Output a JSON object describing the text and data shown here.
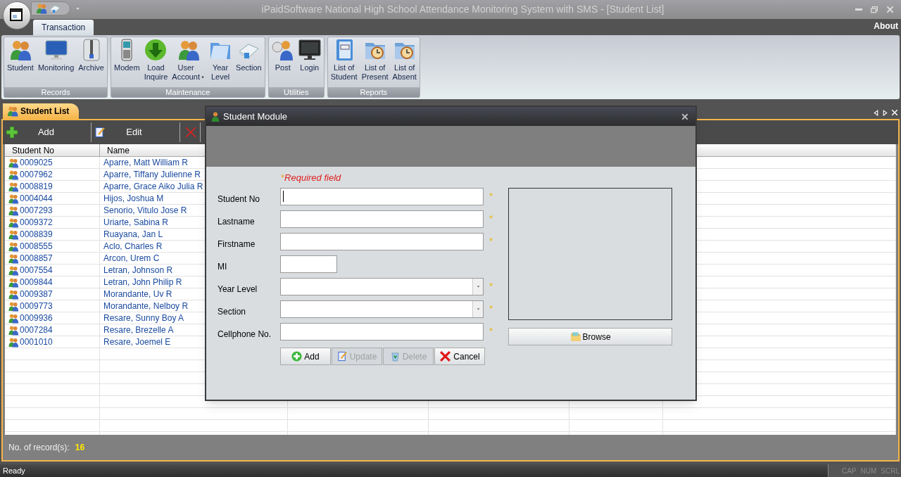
{
  "window": {
    "title": "iPaidSoftware National High School Attendance Monitoring System with SMS - [Student List]"
  },
  "ribbon_tabs": [
    {
      "label": "Transaction",
      "selected": true
    }
  ],
  "menu_right": "About",
  "ribbon_groups": [
    {
      "label": "Records",
      "buttons": [
        {
          "label": "Student"
        },
        {
          "label": "Monitoring"
        },
        {
          "label": "Archive"
        }
      ]
    },
    {
      "label": "Maintenance",
      "buttons": [
        {
          "label": "Modem"
        },
        {
          "label": "Load\nInquire"
        },
        {
          "label": "User\nAccount",
          "dropdown": true
        },
        {
          "label": "Year\nLevel"
        },
        {
          "label": "Section"
        }
      ]
    },
    {
      "label": "Utilities",
      "buttons": [
        {
          "label": "Post"
        },
        {
          "label": "Login"
        }
      ]
    },
    {
      "label": "Reports",
      "buttons": [
        {
          "label": "List of\nStudent"
        },
        {
          "label": "List of\nPresent"
        },
        {
          "label": "List of\nAbsent"
        }
      ]
    }
  ],
  "document_tabs": [
    {
      "label": "Student List",
      "selected": true
    }
  ],
  "toolbar": [
    {
      "kind": "button",
      "label": "Add"
    },
    {
      "kind": "button",
      "label": "Edit"
    },
    {
      "kind": "icon_button"
    }
  ],
  "table": {
    "columns": [
      "Student No",
      "Name"
    ],
    "rows": [
      {
        "student_no": "0009025",
        "name": "Aparre, Matt William R"
      },
      {
        "student_no": "0007962",
        "name": "Aparre, Tiffany Julienne R"
      },
      {
        "student_no": "0008819",
        "name": "Aparre, Grace Aiko Julia R"
      },
      {
        "student_no": "0004044",
        "name": "Hijos, Joshua M"
      },
      {
        "student_no": "0007293",
        "name": "Senorio, Vitulo Jose R"
      },
      {
        "student_no": "0009372",
        "name": "Uriarte, Sabina R"
      },
      {
        "student_no": "0008839",
        "name": "Ruayana, Jan L"
      },
      {
        "student_no": "0008555",
        "name": "Aclo, Charles R"
      },
      {
        "student_no": "0008857",
        "name": "Arcon, Urem C"
      },
      {
        "student_no": "0007554",
        "name": "Letran, Johnson R"
      },
      {
        "student_no": "0009844",
        "name": "Letran, John Philip R"
      },
      {
        "student_no": "0009387",
        "name": "Morandante, Uv R"
      },
      {
        "student_no": "0009773",
        "name": "Morandante, Nelboy R"
      },
      {
        "student_no": "0009936",
        "name": "Resare, Sunny Boy A"
      },
      {
        "student_no": "0007284",
        "name": "Resare, Brezelle A"
      },
      {
        "student_no": "0001010",
        "name": "Resare, Joemel E"
      }
    ]
  },
  "footer": {
    "label": "No. of record(s):",
    "count": "16"
  },
  "dialog": {
    "title": "Student Module",
    "required_note": "Required field",
    "required_mark": "*",
    "fields": [
      {
        "label": "Student No",
        "kind": "text",
        "required": true,
        "focused": true
      },
      {
        "label": "Lastname",
        "kind": "text",
        "required": true,
        "focused": false
      },
      {
        "label": "Firstname",
        "kind": "text",
        "required": true,
        "focused": false
      },
      {
        "label": "MI",
        "kind": "short",
        "required": false,
        "focused": false
      },
      {
        "label": "Year Level",
        "kind": "combo",
        "required": true,
        "focused": false
      },
      {
        "label": "Section",
        "kind": "combo",
        "required": true,
        "focused": false
      },
      {
        "label": "Cellphone No.",
        "kind": "text",
        "required": true,
        "focused": false
      }
    ],
    "buttons": [
      {
        "label": "Add",
        "disabled": false
      },
      {
        "label": "Update",
        "disabled": true
      },
      {
        "label": "Delete",
        "disabled": true
      },
      {
        "label": "Cancel",
        "disabled": false
      }
    ],
    "browse": "Browse"
  },
  "status_bar": {
    "text": "Ready",
    "indicators": [
      {
        "label": "CAP",
        "on": false
      },
      {
        "label": "NUM",
        "on": false
      },
      {
        "label": "SCRL",
        "on": false
      }
    ]
  }
}
